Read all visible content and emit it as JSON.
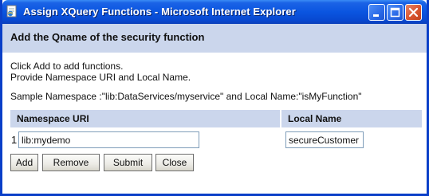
{
  "window": {
    "title": "Assign XQuery Functions - Microsoft Internet Explorer"
  },
  "header": {
    "title": "Add the Qname of the security function"
  },
  "instructions": {
    "line1": "Click Add to add functions.",
    "line2": "Provide Namespace URI and Local Name.",
    "sample": "Sample Namespace :\"lib:DataServices/myservice\" and Local Name:\"isMyFunction\""
  },
  "table": {
    "headers": {
      "namespace": "Namespace URI",
      "local": "Local Name"
    },
    "rows": [
      {
        "index": "1",
        "namespace": "lib:mydemo",
        "local": "secureCustomer"
      }
    ]
  },
  "buttons": {
    "add": "Add",
    "remove": "Remove",
    "submit": "Submit",
    "close": "Close"
  },
  "colors": {
    "titlebar": "#0a55e0",
    "band": "#cbd6ec",
    "close_button": "#d9542e"
  },
  "icons": {
    "app": "ie-page-icon",
    "minimize": "minimize-icon",
    "maximize": "maximize-icon",
    "close": "close-icon"
  }
}
